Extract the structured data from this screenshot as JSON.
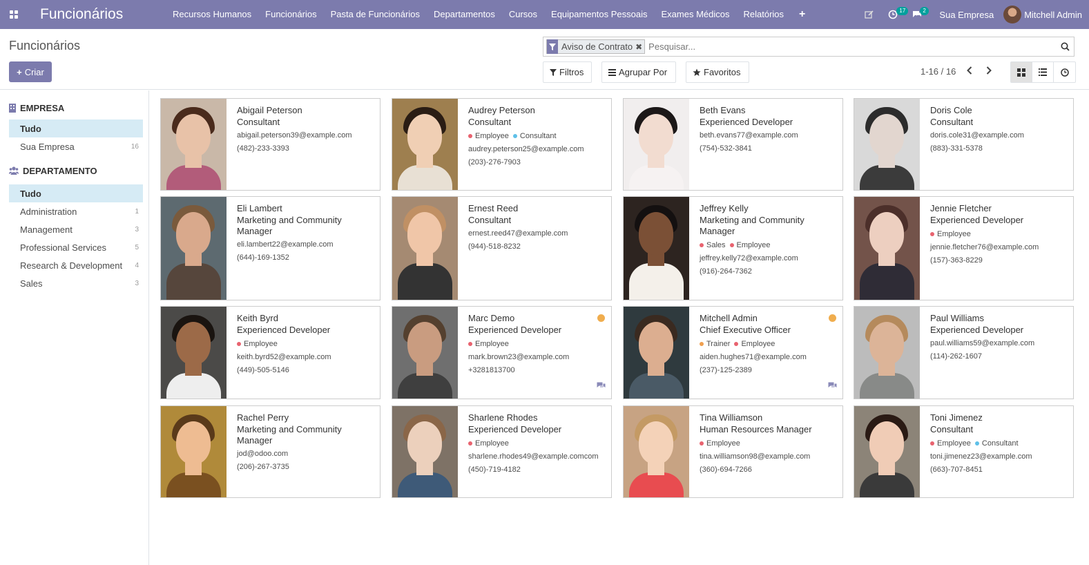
{
  "app": {
    "title": "Funcionários"
  },
  "menu": [
    "Recursos Humanos",
    "Funcionários",
    "Pasta de Funcionários",
    "Departamentos",
    "Cursos",
    "Equipamentos Pessoais",
    "Exames Médicos",
    "Relatórios"
  ],
  "systray": {
    "activity_count": "17",
    "message_count": "2",
    "company": "Sua Empresa",
    "user": "Mitchell Admin"
  },
  "control_panel": {
    "breadcrumb": "Funcionários",
    "create_label": "Criar",
    "facet_label": "Aviso de Contrato",
    "search_placeholder": "Pesquisar...",
    "filters_label": "Filtros",
    "groupby_label": "Agrupar Por",
    "favorites_label": "Favoritos",
    "pager": "1-16 / 16"
  },
  "sidebar": {
    "company_title": "EMPRESA",
    "company_items": [
      {
        "label": "Tudo",
        "count": ""
      },
      {
        "label": "Sua Empresa",
        "count": "16"
      }
    ],
    "department_title": "DEPARTAMENTO",
    "department_items": [
      {
        "label": "Tudo",
        "count": ""
      },
      {
        "label": "Administration",
        "count": "1"
      },
      {
        "label": "Management",
        "count": "3"
      },
      {
        "label": "Professional Services",
        "count": "5"
      },
      {
        "label": "Research & Development",
        "count": "4"
      },
      {
        "label": "Sales",
        "count": "3"
      }
    ]
  },
  "colors": {
    "brand": "#7c7bad",
    "tag_employee": "#e8636f",
    "tag_consultant": "#5ec0e8",
    "tag_trainer": "#f0a050",
    "tag_sales": "#e8636f",
    "status_away": "#f0ad4e"
  },
  "employees": [
    {
      "name": "Abigail Peterson",
      "job": "Consultant",
      "tags": [],
      "email": "abigail.peterson39@example.com",
      "phone": "(482)-233-3393"
    },
    {
      "name": "Audrey Peterson",
      "job": "Consultant",
      "tags": [
        "Employee",
        "Consultant"
      ],
      "email": "audrey.peterson25@example.com",
      "phone": "(203)-276-7903"
    },
    {
      "name": "Beth Evans",
      "job": "Experienced Developer",
      "tags": [],
      "email": "beth.evans77@example.com",
      "phone": "(754)-532-3841"
    },
    {
      "name": "Doris Cole",
      "job": "Consultant",
      "tags": [],
      "email": "doris.cole31@example.com",
      "phone": "(883)-331-5378"
    },
    {
      "name": "Eli Lambert",
      "job": "Marketing and Community Manager",
      "tags": [],
      "email": "eli.lambert22@example.com",
      "phone": "(644)-169-1352"
    },
    {
      "name": "Ernest Reed",
      "job": "Consultant",
      "tags": [],
      "email": "ernest.reed47@example.com",
      "phone": "(944)-518-8232"
    },
    {
      "name": "Jeffrey Kelly",
      "job": "Marketing and Community Manager",
      "tags": [
        "Sales",
        "Employee"
      ],
      "email": "jeffrey.kelly72@example.com",
      "phone": "(916)-264-7362"
    },
    {
      "name": "Jennie Fletcher",
      "job": "Experienced Developer",
      "tags": [
        "Employee"
      ],
      "email": "jennie.fletcher76@example.com",
      "phone": "(157)-363-8229"
    },
    {
      "name": "Keith Byrd",
      "job": "Experienced Developer",
      "tags": [
        "Employee"
      ],
      "email": "keith.byrd52@example.com",
      "phone": "(449)-505-5146"
    },
    {
      "name": "Marc Demo",
      "job": "Experienced Developer",
      "tags": [
        "Employee"
      ],
      "email": "mark.brown23@example.com",
      "phone": "+3281813700"
    },
    {
      "name": "Mitchell Admin",
      "job": "Chief Executive Officer",
      "tags": [
        "Trainer",
        "Employee"
      ],
      "email": "aiden.hughes71@example.com",
      "phone": "(237)-125-2389"
    },
    {
      "name": "Paul Williams",
      "job": "Experienced Developer",
      "tags": [],
      "email": "paul.williams59@example.com",
      "phone": "(114)-262-1607"
    },
    {
      "name": "Rachel Perry",
      "job": "Marketing and Community Manager",
      "tags": [],
      "email": "jod@odoo.com",
      "phone": "(206)-267-3735"
    },
    {
      "name": "Sharlene Rhodes",
      "job": "Experienced Developer",
      "tags": [
        "Employee"
      ],
      "email": "sharlene.rhodes49@example.comcom",
      "phone": "(450)-719-4182"
    },
    {
      "name": "Tina Williamson",
      "job": "Human Resources Manager",
      "tags": [
        "Employee"
      ],
      "email": "tina.williamson98@example.com",
      "phone": "(360)-694-7266"
    },
    {
      "name": "Toni Jimenez",
      "job": "Consultant",
      "tags": [
        "Employee",
        "Consultant"
      ],
      "email": "toni.jimenez23@example.com",
      "phone": "(663)-707-8451"
    }
  ]
}
